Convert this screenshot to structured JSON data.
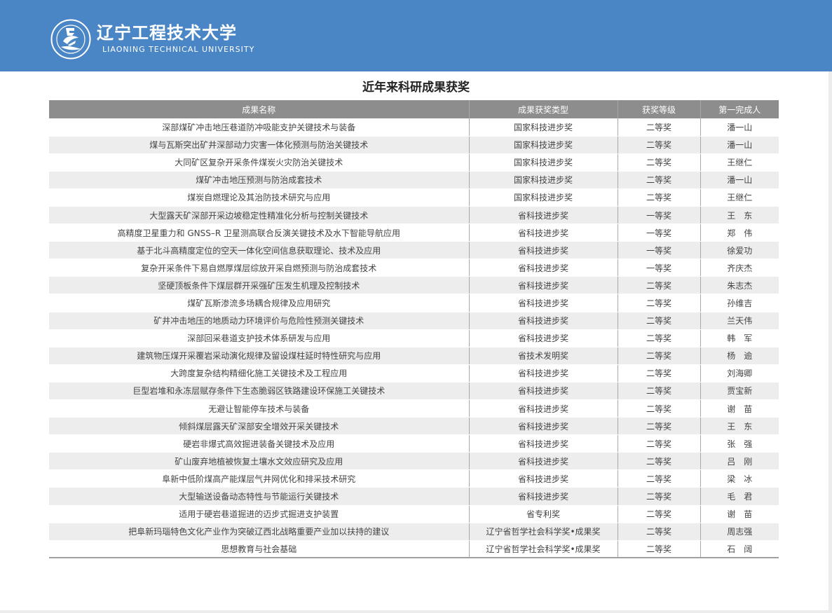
{
  "header": {
    "brand_cn": "辽宁工程技术大学",
    "brand_en": "LIAONING TECHNICAL UNIVERSITY",
    "bg_color": "#4a86c5",
    "logo_icon": "university-seal-icon"
  },
  "page": {
    "title": "近年来科研成果获奖"
  },
  "table": {
    "columns": [
      "成果名称",
      "成果获奖类型",
      "获奖等级",
      "第一完成人"
    ],
    "rows": [
      {
        "name": "深部煤矿冲击地压巷道防冲吸能支护关键技术与装备",
        "type": "国家科技进步奖",
        "level": "二等奖",
        "person": "潘一山"
      },
      {
        "name": "煤与瓦斯突出矿井深部动力灾害一体化预测与防治关键技术",
        "type": "国家科技进步奖",
        "level": "二等奖",
        "person": "潘一山"
      },
      {
        "name": "大同矿区复杂开采条件煤炭火灾防治关键技术",
        "type": "国家科技进步奖",
        "level": "二等奖",
        "person": "王继仁"
      },
      {
        "name": "煤矿冲击地压预测与防治成套技术",
        "type": "国家科技进步奖",
        "level": "二等奖",
        "person": "潘一山"
      },
      {
        "name": "煤炭自燃理论及其治防技术研究与应用",
        "type": "国家科技进步奖",
        "level": "二等奖",
        "person": "王继仁"
      },
      {
        "name": "大型露天矿深部开采边坡稳定性精准化分析与控制关键技术",
        "type": "省科技进步奖",
        "level": "一等奖",
        "person": "王　东"
      },
      {
        "name": "高精度卫星重力和 GNSS–R 卫星测高联合反演关键技术及水下智能导航应用",
        "type": "省科技进步奖",
        "level": "一等奖",
        "person": "郑　伟"
      },
      {
        "name": "基于北斗高精度定位的空天一体化空间信息获取理论、技术及应用",
        "type": "省科技进步奖",
        "level": "一等奖",
        "person": "徐爱功"
      },
      {
        "name": "复杂开采条件下易自燃厚煤层综放开采自燃预测与防治成套技术",
        "type": "省科技进步奖",
        "level": "一等奖",
        "person": "齐庆杰"
      },
      {
        "name": "坚硬顶板条件下煤层群开采强矿压发生机理及控制技术",
        "type": "省科技进步奖",
        "level": "二等奖",
        "person": "朱志杰"
      },
      {
        "name": "煤矿瓦斯渗流多场耦合规律及应用研究",
        "type": "省科技进步奖",
        "level": "二等奖",
        "person": "孙维吉"
      },
      {
        "name": "矿井冲击地压的地质动力环境评价与危险性预测关键技术",
        "type": "省科技进步奖",
        "level": "二等奖",
        "person": "兰天伟"
      },
      {
        "name": "深部回采巷道支护技术体系研发与应用",
        "type": "省科技进步奖",
        "level": "二等奖",
        "person": "韩　军"
      },
      {
        "name": "建筑物压煤开采覆岩采动演化规律及留设煤柱延时特性研究与应用",
        "type": "省技术发明奖",
        "level": "二等奖",
        "person": "杨　逾"
      },
      {
        "name": "大跨度复杂结构精细化施工关键技术及工程应用",
        "type": "省科技进步奖",
        "level": "二等奖",
        "person": "刘海卿"
      },
      {
        "name": "巨型岩堆和永冻层赋存条件下生态脆弱区铁路建设环保施工关键技术",
        "type": "省科技进步奖",
        "level": "二等奖",
        "person": "贾宝新"
      },
      {
        "name": "无避让智能停车技术与装备",
        "type": "省科技进步奖",
        "level": "二等奖",
        "person": "谢　苗"
      },
      {
        "name": "倾斜煤层露天矿深部安全增效开采关键技术",
        "type": "省科技进步奖",
        "level": "二等奖",
        "person": "王　东"
      },
      {
        "name": "硬岩非爆式高效掘进装备关键技术及应用",
        "type": "省科技进步奖",
        "level": "二等奖",
        "person": "张　强"
      },
      {
        "name": "矿山废弃地植被恢复土壤水文效应研究及应用",
        "type": "省科技进步奖",
        "level": "二等奖",
        "person": "吕　刚"
      },
      {
        "name": "阜新中低阶煤高产能煤层气井网优化和排采技术研究",
        "type": "省科技进步奖",
        "level": "二等奖",
        "person": "梁　冰"
      },
      {
        "name": "大型输送设备动态特性与节能运行关键技术",
        "type": "省科技进步奖",
        "level": "二等奖",
        "person": "毛　君"
      },
      {
        "name": "适用于硬岩巷道掘进的迈步式掘进支护装置",
        "type": "省专利奖",
        "level": "二等奖",
        "person": "谢　苗"
      },
      {
        "name": "把阜新玛瑙特色文化产业作为突破辽西北战略重要产业加以扶持的建议",
        "type": "辽宁省哲学社会科学奖•成果奖",
        "level": "二等奖",
        "person": "周志强"
      },
      {
        "name": "思想教育与社会基础",
        "type": "辽宁省哲学社会科学奖•成果奖",
        "level": "二等奖",
        "person": "石　阔"
      }
    ]
  }
}
